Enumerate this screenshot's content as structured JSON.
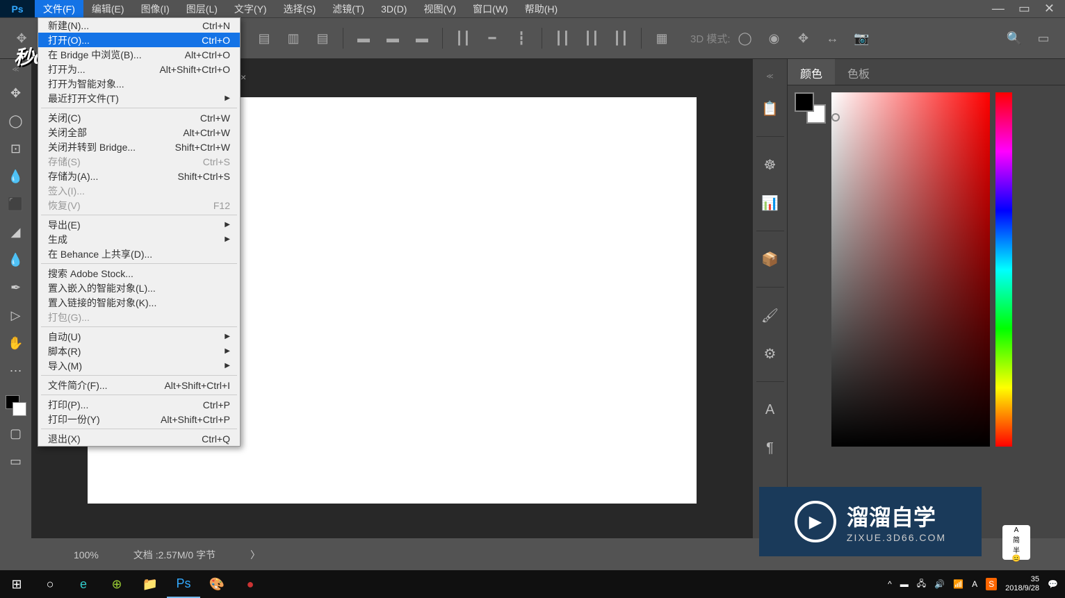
{
  "menubar": {
    "items": [
      "文件(F)",
      "编辑(E)",
      "图像(I)",
      "图层(L)",
      "文字(Y)",
      "选择(S)",
      "滤镜(T)",
      "3D(D)",
      "视图(V)",
      "窗口(W)",
      "帮助(H)"
    ]
  },
  "options": {
    "mode_3d_label": "3D 模式:"
  },
  "file_menu": {
    "new": {
      "label": "新建(N)...",
      "shortcut": "Ctrl+N"
    },
    "open": {
      "label": "打开(O)...",
      "shortcut": "Ctrl+O"
    },
    "browse_bridge": {
      "label": "在 Bridge 中浏览(B)...",
      "shortcut": "Alt+Ctrl+O"
    },
    "open_as": {
      "label": "打开为...",
      "shortcut": "Alt+Shift+Ctrl+O"
    },
    "open_smart": {
      "label": "打开为智能对象..."
    },
    "recent": {
      "label": "最近打开文件(T)"
    },
    "close": {
      "label": "关闭(C)",
      "shortcut": "Ctrl+W"
    },
    "close_all": {
      "label": "关闭全部",
      "shortcut": "Alt+Ctrl+W"
    },
    "close_bridge": {
      "label": "关闭并转到 Bridge...",
      "shortcut": "Shift+Ctrl+W"
    },
    "save": {
      "label": "存储(S)",
      "shortcut": "Ctrl+S"
    },
    "save_as": {
      "label": "存储为(A)...",
      "shortcut": "Shift+Ctrl+S"
    },
    "checkin": {
      "label": "签入(I)..."
    },
    "revert": {
      "label": "恢复(V)",
      "shortcut": "F12"
    },
    "export": {
      "label": "导出(E)"
    },
    "generate": {
      "label": "生成"
    },
    "behance": {
      "label": "在 Behance 上共享(D)..."
    },
    "adobe_stock": {
      "label": "搜索 Adobe Stock..."
    },
    "place_embedded": {
      "label": "置入嵌入的智能对象(L)..."
    },
    "place_linked": {
      "label": "置入链接的智能对象(K)..."
    },
    "package": {
      "label": "打包(G)..."
    },
    "automate": {
      "label": "自动(U)"
    },
    "scripts": {
      "label": "脚本(R)"
    },
    "import": {
      "label": "导入(M)"
    },
    "file_info": {
      "label": "文件简介(F)...",
      "shortcut": "Alt+Shift+Ctrl+I"
    },
    "print": {
      "label": "打印(P)...",
      "shortcut": "Ctrl+P"
    },
    "print_one": {
      "label": "打印一份(Y)",
      "shortcut": "Alt+Shift+Ctrl+P"
    },
    "exit": {
      "label": "退出(X)",
      "shortcut": "Ctrl+Q"
    }
  },
  "panels": {
    "color_tab": "颜色",
    "swatches_tab": "色板"
  },
  "status": {
    "zoom": "100%",
    "doc_info": "文档 :2.57M/0 字节"
  },
  "watermarks": {
    "top_logo": "秒dong视频",
    "right_text": "溜溜自学",
    "right_sub": "ZIXUE.3D66.COM"
  },
  "sticker": {
    "line1": "A",
    "line2": "简",
    "line3": "半"
  },
  "taskbar": {
    "time": "35",
    "date": "2018/9/28"
  }
}
